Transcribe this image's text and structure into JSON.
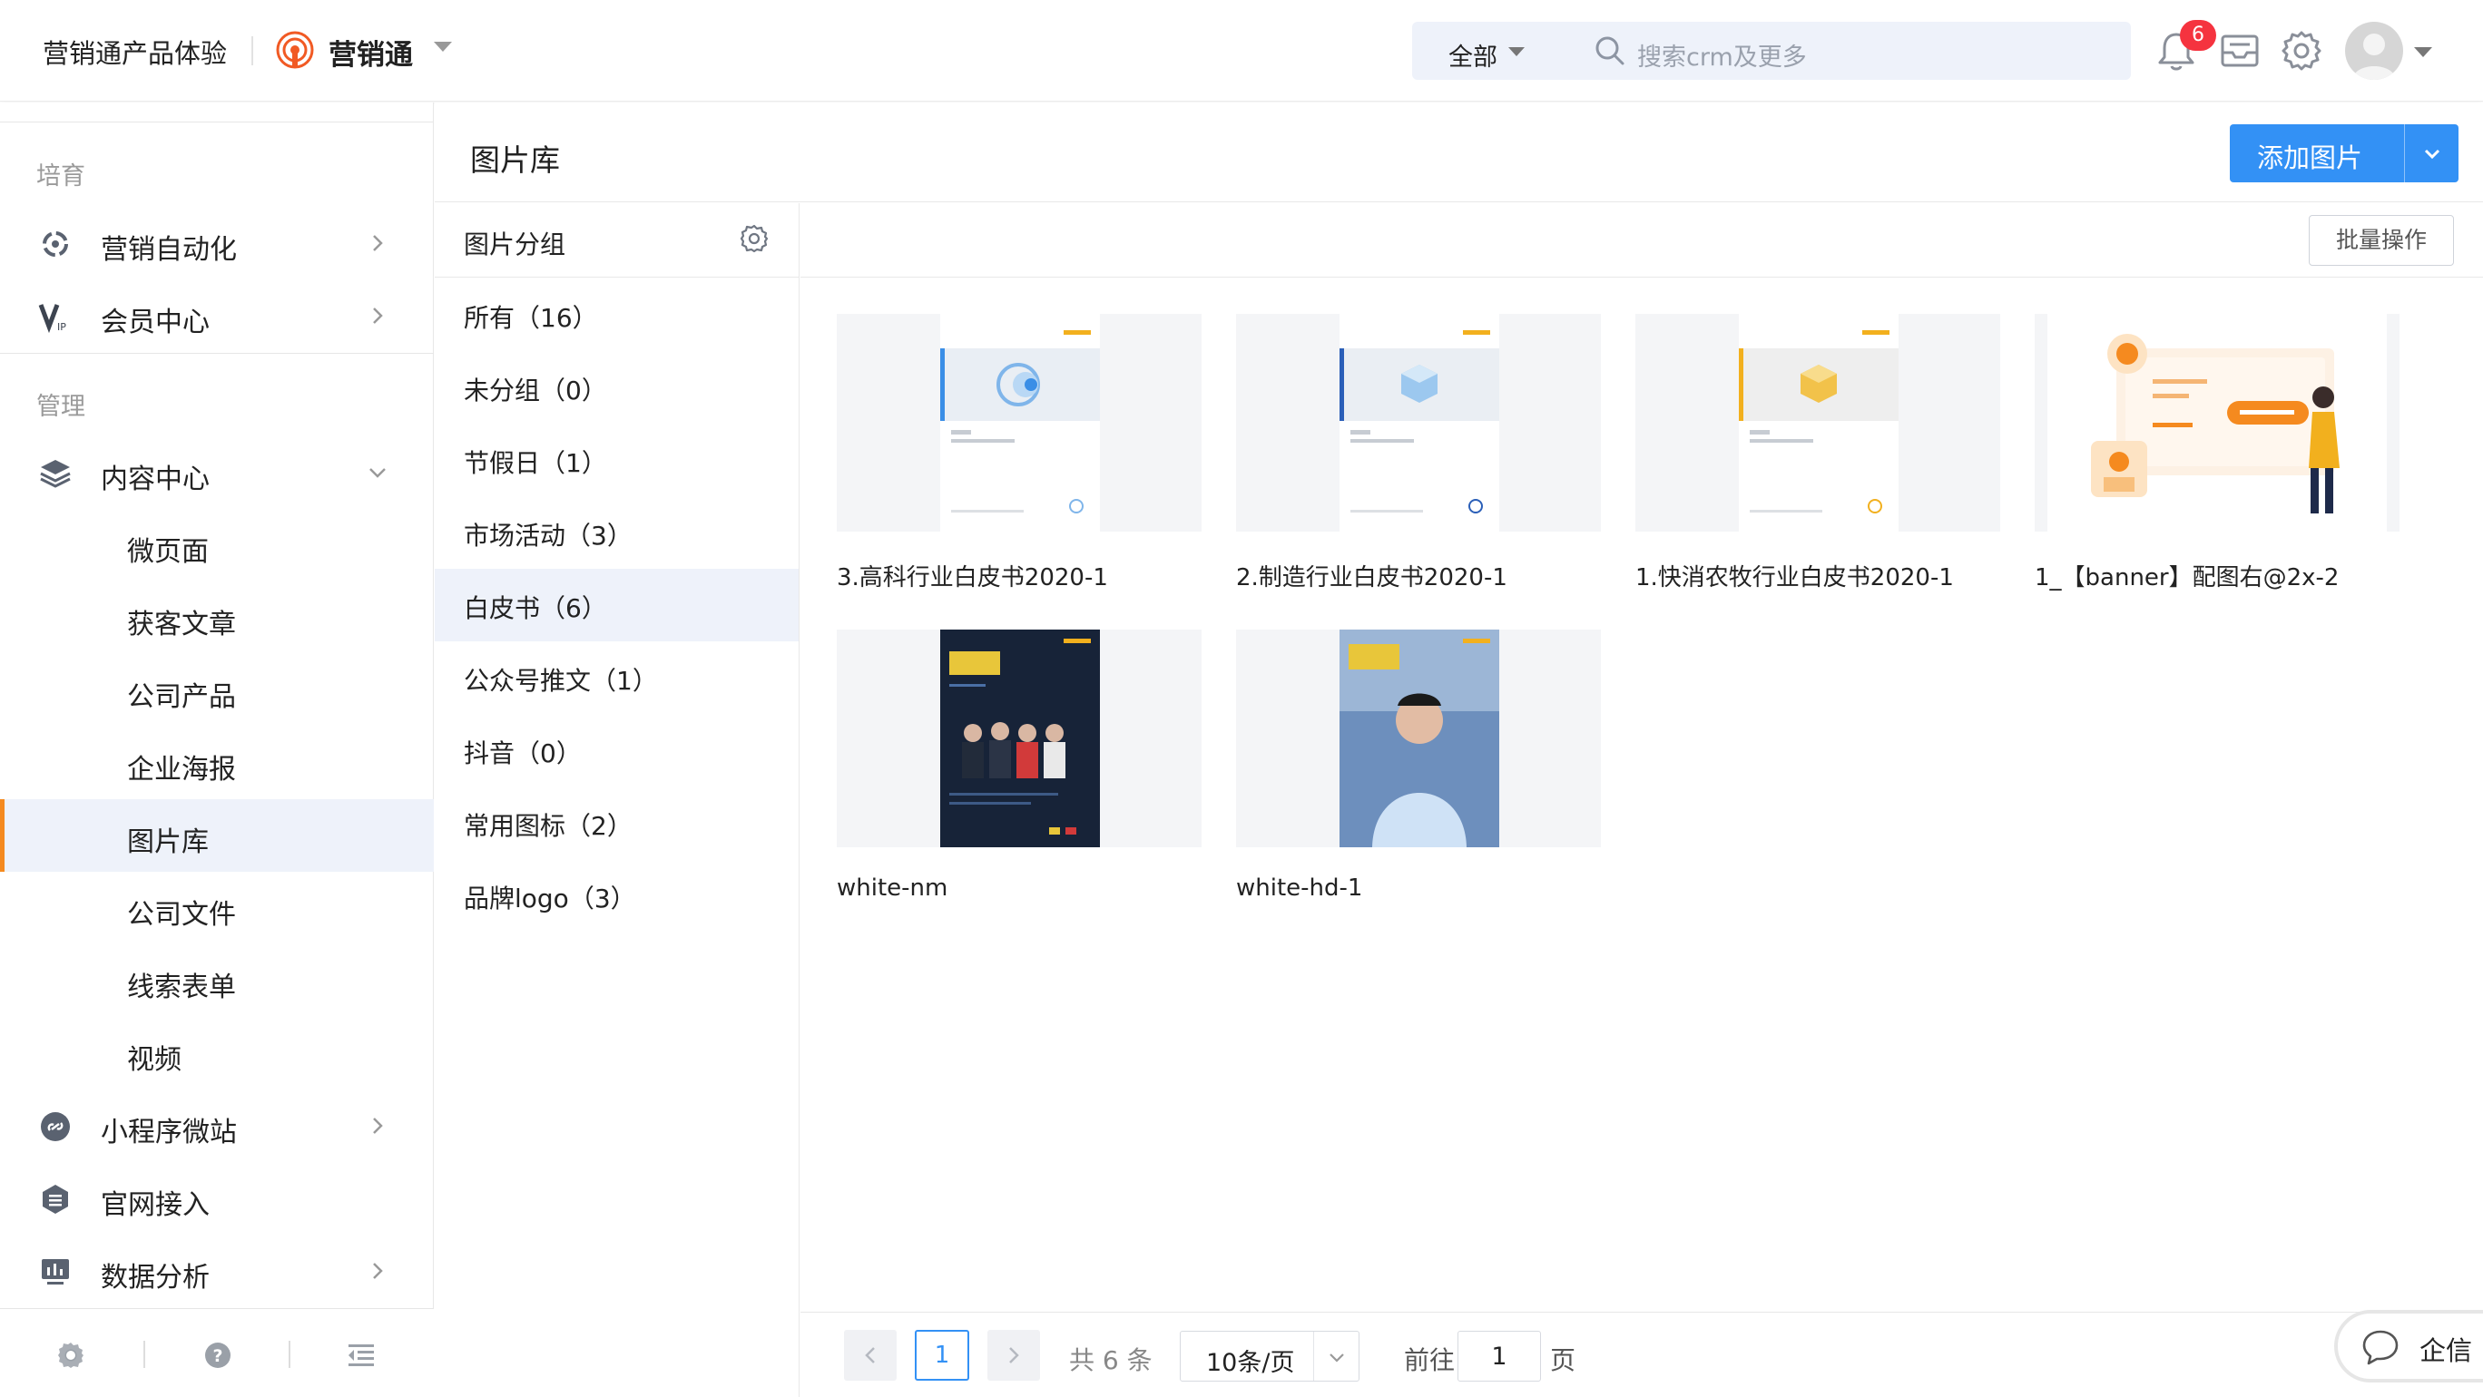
{
  "header": {
    "product_title": "营销通产品体验",
    "app_name": "营销通",
    "search_scope": "全部",
    "search_placeholder": "搜索crm及更多",
    "notification_count": "6"
  },
  "sidebar": {
    "section_cultivate": "培育",
    "section_manage": "管理",
    "items": [
      {
        "label": "营销自动化",
        "icon": "automation-icon"
      },
      {
        "label": "会员中心",
        "icon": "vip-icon"
      },
      {
        "label": "内容中心",
        "icon": "layers-icon"
      },
      {
        "label": "小程序微站",
        "icon": "link-icon"
      },
      {
        "label": "官网接入",
        "icon": "website-icon"
      },
      {
        "label": "数据分析",
        "icon": "chart-icon"
      }
    ],
    "sub_items": [
      "微页面",
      "获客文章",
      "公司产品",
      "企业海报",
      "图片库",
      "公司文件",
      "线索表单",
      "视频"
    ],
    "active_sub": "图片库"
  },
  "page": {
    "title": "图片库",
    "add_button": "添加图片",
    "batch_button": "批量操作"
  },
  "groups": {
    "title": "图片分组",
    "items": [
      "所有（16）",
      "未分组（0）",
      "节假日（1）",
      "市场活动（3）",
      "白皮书（6）",
      "公众号推文（1）",
      "抖音（0）",
      "常用图标（2）",
      "品牌logo（3）"
    ],
    "active": "白皮书（6）"
  },
  "images": [
    {
      "name": "3.高科行业白皮书2020-1",
      "accent": "#3a8ee6"
    },
    {
      "name": "2.制造行业白皮书2020-1",
      "accent": "#2b5fb8"
    },
    {
      "name": "1.快消农牧行业白皮书2020-1",
      "accent": "#f2b01e"
    },
    {
      "name": "1_【banner】配图右@2x-2",
      "accent": "#f58a1f"
    },
    {
      "name": "white-nm",
      "accent": "#e8c63a"
    },
    {
      "name": "white-hd-1",
      "accent": "#e8c63a"
    }
  ],
  "pagination": {
    "current": "1",
    "total": "共 6 条",
    "page_size": "10条/页",
    "goto_label": "前往",
    "goto_value": "1",
    "page_suffix": "页"
  },
  "widget": {
    "qixin_label": "企信"
  }
}
